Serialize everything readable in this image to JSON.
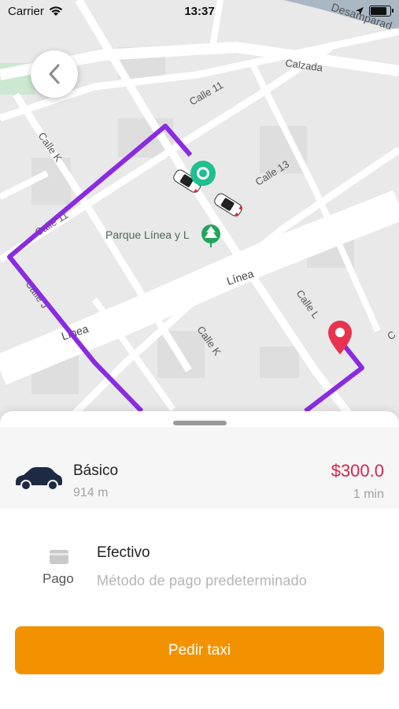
{
  "status_bar": {
    "carrier": "Carrier",
    "time": "13:37",
    "icons": [
      "wifi-icon",
      "location-arrow-icon",
      "battery-icon"
    ]
  },
  "map": {
    "street_labels": {
      "calle_11_top": "Calle 11",
      "calzada": "Calzada",
      "desamparados": "Desamparad",
      "calle_k_top": "Calle K",
      "calle_13": "Calle 13",
      "calle_11_left": "Calle 11",
      "parque": "Parque Línea y L",
      "calle_j": "Calle J",
      "linea_center": "Línea",
      "linea_left": "Línea",
      "calle_l": "Calle L",
      "calle_k_bottom": "Calle K",
      "calle_c": "C"
    },
    "colors": {
      "route": "#8a2be2",
      "origin": "#1fbf8f",
      "destination": "#e8334f",
      "park": "#22a45a"
    }
  },
  "ride": {
    "name": "Básico",
    "distance": "914 m",
    "price": "$300.0",
    "eta": "1 min",
    "price_color": "#d9234d"
  },
  "payment": {
    "label": "Pago",
    "method": "Efectivo",
    "subtitle": "Método de pago predeterminado"
  },
  "cta": {
    "label": "Pedir taxi",
    "color": "#f39200"
  }
}
